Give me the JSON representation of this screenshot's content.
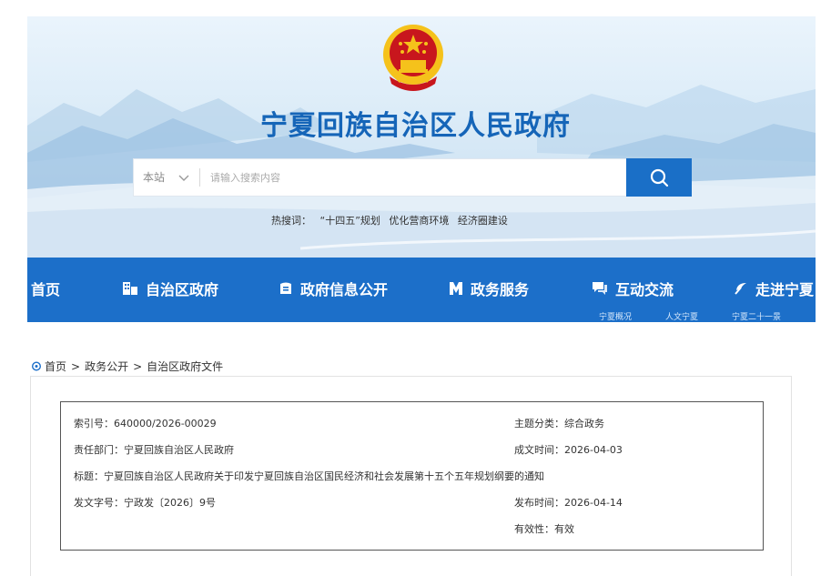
{
  "site_title": "宁夏回族自治区人民政府",
  "search": {
    "scope_label": "本站",
    "placeholder": "请输入搜索内容",
    "hot_label": "热搜词：",
    "hot_words": [
      "“十四五”规划",
      "优化营商环境",
      "经济圈建设"
    ]
  },
  "nav": {
    "items": [
      {
        "label": "首页",
        "icon": "none"
      },
      {
        "label": "自治区政府",
        "icon": "building-icon"
      },
      {
        "label": "政府信息公开",
        "icon": "document-icon"
      },
      {
        "label": "政务服务",
        "icon": "service-icon"
      },
      {
        "label": "互动交流",
        "icon": "chat-icon"
      },
      {
        "label": "走进宁夏",
        "icon": "leaf-icon"
      }
    ],
    "sub_links": [
      "宁夏概况",
      "人文宁夏",
      "宁夏二十一景"
    ]
  },
  "breadcrumb": [
    "首页",
    "政务公开",
    "自治区政府文件"
  ],
  "document": {
    "index_label": "索引号：",
    "index_value": "640000/2026-00029",
    "dept_label": "责任部门：",
    "dept_value": "宁夏回族自治区人民政府",
    "title_label": "标题：",
    "title_value": "宁夏回族自治区人民政府关于印发宁夏回族自治区国民经济和社会发展第十五个五年规划纲要的通知",
    "docno_label": "发文字号：",
    "docno_value": "宁政发〔2026〕9号",
    "topic_label": "主题分类：",
    "topic_value": "综合政务",
    "created_label": "成文时间：",
    "created_value": "2026-04-03",
    "published_label": "发布时间：",
    "published_value": "2026-04-14",
    "validity_label": "有效性：",
    "validity_value": "有效"
  },
  "colors": {
    "brand_blue": "#1c6fc9",
    "title_blue": "#1565b8",
    "emblem_red": "#c8161d",
    "emblem_gold": "#f5c21b"
  }
}
